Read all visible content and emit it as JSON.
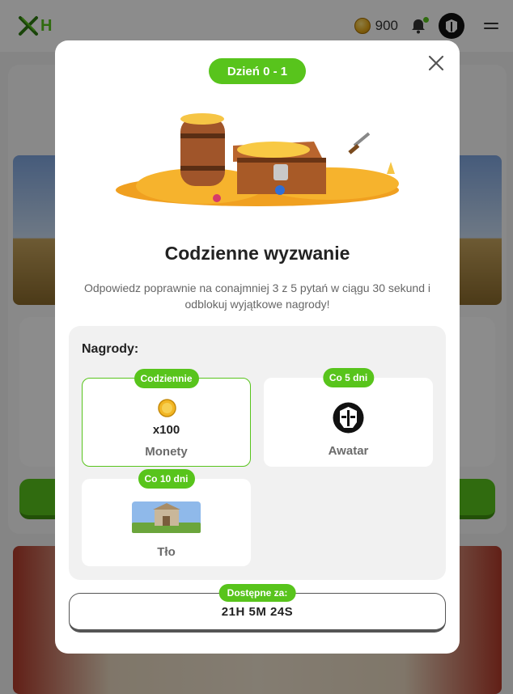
{
  "app": {
    "logo_text": "H",
    "coins": "900"
  },
  "modal": {
    "day_badge": "Dzień 0 - 1",
    "title": "Codzienne wyzwanie",
    "description": "Odpowiedz poprawnie na conajmniej 3 z 5 pytań w ciągu 30 sekund i odblokuj wyjątkowe nagrody!",
    "rewards_heading": "Nagrody:",
    "rewards": [
      {
        "tag": "Codziennie",
        "quantity": "x100",
        "name": "Monety",
        "icon": "coin-icon"
      },
      {
        "tag": "Co 5 dni",
        "name": "Awatar",
        "icon": "avatar-icon"
      },
      {
        "tag": "Co 10 dni",
        "name": "Tło",
        "icon": "background-image"
      }
    ],
    "timer_label": "Dostępne za:",
    "timer_value": "21H 5M 24S"
  },
  "colors": {
    "accent": "#58c41c",
    "overlay": "rgba(0,0,0,0.45)"
  }
}
